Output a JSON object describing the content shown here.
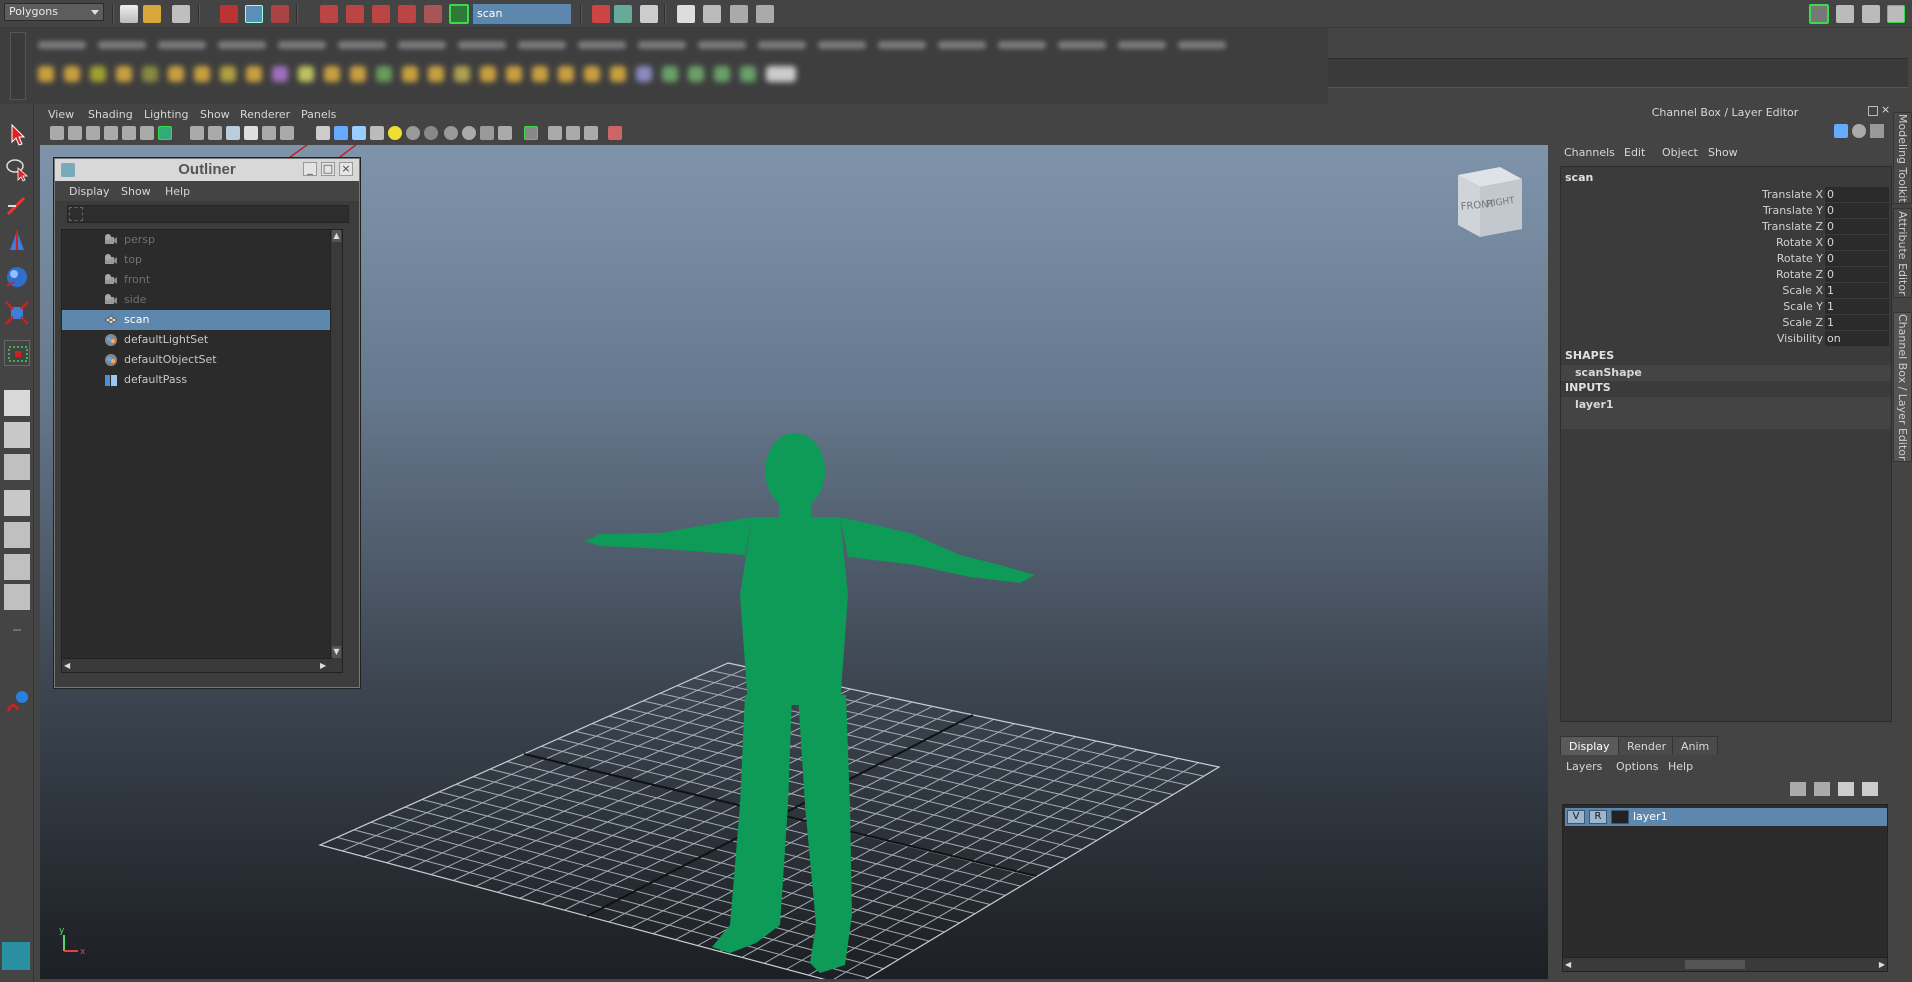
{
  "statusline": {
    "mode": "Polygons",
    "selection_field": "scan"
  },
  "viewport": {
    "menus": [
      "View",
      "Shading",
      "Lighting",
      "Show",
      "Renderer",
      "Panels"
    ],
    "viewcube": {
      "front": "FRONT",
      "right": "RIGHT"
    }
  },
  "outliner": {
    "title": "Outliner",
    "menus": [
      "Display",
      "Show",
      "Help"
    ],
    "items": [
      {
        "label": "persp",
        "icon": "camera-icon",
        "dim": true
      },
      {
        "label": "top",
        "icon": "camera-icon",
        "dim": true
      },
      {
        "label": "front",
        "icon": "camera-icon",
        "dim": true
      },
      {
        "label": "side",
        "icon": "camera-icon",
        "dim": true
      },
      {
        "label": "scan",
        "icon": "mesh-icon",
        "selected": true
      },
      {
        "label": "defaultLightSet",
        "icon": "set-icon"
      },
      {
        "label": "defaultObjectSet",
        "icon": "set-icon"
      },
      {
        "label": "defaultPass",
        "icon": "render-pass-icon"
      }
    ]
  },
  "channel_box": {
    "title": "Channel Box / Layer Editor",
    "menus": [
      "Channels",
      "Edit",
      "Object",
      "Show"
    ],
    "object_name": "scan",
    "attributes": [
      {
        "label": "Translate X",
        "value": "0"
      },
      {
        "label": "Translate Y",
        "value": "0"
      },
      {
        "label": "Translate Z",
        "value": "0"
      },
      {
        "label": "Rotate X",
        "value": "0"
      },
      {
        "label": "Rotate Y",
        "value": "0"
      },
      {
        "label": "Rotate Z",
        "value": "0"
      },
      {
        "label": "Scale X",
        "value": "1"
      },
      {
        "label": "Scale Y",
        "value": "1"
      },
      {
        "label": "Scale Z",
        "value": "1"
      },
      {
        "label": "Visibility",
        "value": "on"
      }
    ],
    "shapes_header": "SHAPES",
    "shape": "scanShape",
    "inputs_header": "INPUTS",
    "input": "layer1"
  },
  "side_tabs": [
    "Modeling Toolkit",
    "Attribute Editor",
    "Channel Box / Layer Editor"
  ],
  "layer_editor": {
    "tabs": [
      "Display",
      "Render",
      "Anim"
    ],
    "menus": [
      "Layers",
      "Options",
      "Help"
    ],
    "layer": {
      "visible": "V",
      "render": "R",
      "name": "layer1"
    }
  },
  "colors": {
    "selection": "#5d87ad",
    "mesh": "#0e9a57",
    "annotation": "#d01010"
  }
}
